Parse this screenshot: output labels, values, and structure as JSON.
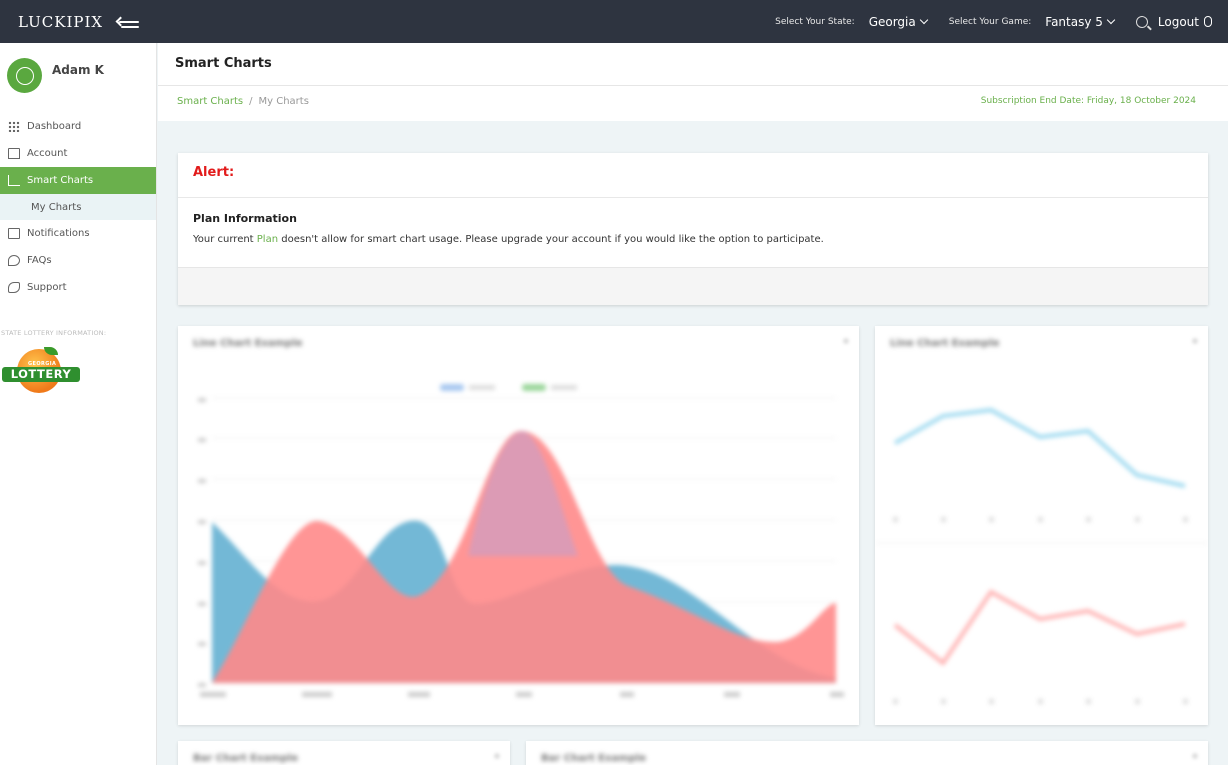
{
  "app": {
    "logo": "LUCKIPIX"
  },
  "topbar": {
    "state_label": "Select Your State:",
    "state_value": "Georgia",
    "game_label": "Select Your Game:",
    "game_value": "Fantasy 5",
    "logout_label": "Logout"
  },
  "sidebar": {
    "user_name": "Adam K",
    "items": [
      {
        "label": "Dashboard",
        "icon": "grid-icon"
      },
      {
        "label": "Account",
        "icon": "home-icon"
      },
      {
        "label": "Smart Charts",
        "icon": "chart-icon",
        "active": true
      },
      {
        "label": "Notifications",
        "icon": "mail-icon"
      },
      {
        "label": "FAQs",
        "icon": "paper-plane-icon"
      },
      {
        "label": "Support",
        "icon": "phone-icon"
      }
    ],
    "sub_items": [
      {
        "label": "My Charts"
      }
    ],
    "state_info_label": "STATE LOTTERY INFORMATION:",
    "lottery_logo": {
      "brand_top": "GEORGIA",
      "brand_word": "LOTTERY"
    }
  },
  "page": {
    "title": "Smart Charts",
    "breadcrumb": [
      "Smart Charts",
      "My Charts"
    ],
    "subscription": "Subscription End Date: Friday, 18 October 2024"
  },
  "alert": {
    "title": "Alert:",
    "plan_title": "Plan Information",
    "text_before": "Your current ",
    "link": "Plan",
    "text_after": " doesn't allow for smart chart usage. Please upgrade your account if you would like the option to participate."
  },
  "colors": {
    "accent": "#6ab04c",
    "topbar": "#2e3440",
    "alert": "#e21b1b",
    "area_blue": "#6bb4d4",
    "area_red": "#ff8a8a",
    "line_blue": "#9fdaf0",
    "line_red": "#ffb3b3"
  }
}
